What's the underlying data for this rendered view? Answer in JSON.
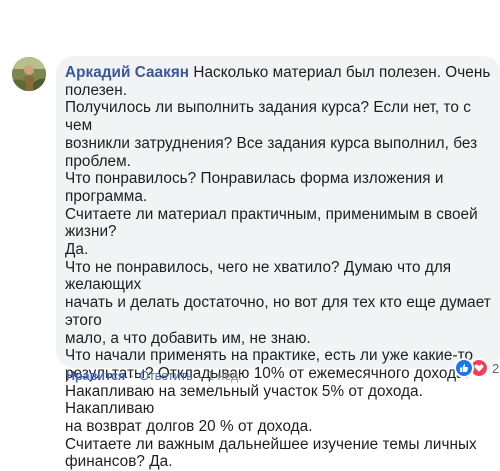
{
  "comment": {
    "author": "Аркадий Саакян",
    "paragraphs": [
      "Насколько материал был полезен. Очень\nполезен.",
      "Получилось ли выполнить задания курса? Если нет, то с чем\nвозникли затруднения? Все задания курса выполнил, без\nпроблем.",
      "Что понравилось? Понравилась форма изложения и программа.",
      "Считаете ли материал практичным, применимым в своей жизни?\nДа.",
      "Что не понравилось, чего не хватило? Думаю что для желающих\nначать и делать достаточно, но вот для тех кто еще думает этого\nмало, а что добавить им, не знаю.",
      "Что начали применять на практике, есть ли уже какие-то\nрезультаты? Откладываю 10% от ежемесячного дохода.",
      "Накапливаю на земельный участок 5% от дохода. Накапливаю\nна возврат долгов 20 % от дохода.",
      "Считаете ли важным дальнейшее изучение темы личных\nфинансов? Да."
    ]
  },
  "reactions": {
    "count": "2",
    "icons": [
      "like-icon",
      "love-icon"
    ],
    "like_color": "#1877f2",
    "love_color": "#f33e58"
  },
  "actions": {
    "like_label": "Нравится",
    "reply_label": "Ответить",
    "separator": "·",
    "time": "1 нед."
  }
}
